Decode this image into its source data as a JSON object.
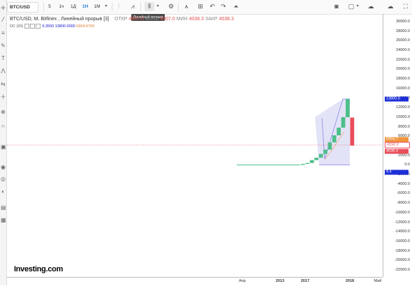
{
  "toolbar": {
    "symbol": "BTC/USD",
    "intervals": [
      "5",
      "1ч",
      "1Д",
      "1Н",
      "1М"
    ],
    "active_interval": "1Н",
    "tooltip": "Линейный прорыв"
  },
  "legend": {
    "title": "BTC/USD, M, Bitfinex , Линейный прорыв [3]",
    "open_label": "ОТКР",
    "open_value": "4907.0",
    "high_label": "МАКС",
    "high_value": "9907.0",
    "low_label": "МИН",
    "low_value": "4038.3",
    "close_label": "ЗАКР",
    "close_value": "4038.3"
  },
  "indicator": {
    "name": "DC (20)",
    "v1": "9.3500",
    "v2": "13800.0000",
    "v3": "6904.6750"
  },
  "yaxis": {
    "ticks": [
      "30000.0",
      "28000.0",
      "26000.0",
      "24000.0",
      "22000.0",
      "20000.0",
      "18000.0",
      "16000.0",
      "14000.0",
      "12000.0",
      "10000.0",
      "8000.0",
      "6000.0",
      "4000.0",
      "2000.0",
      "0.0",
      "-2000.0",
      "-4000.0",
      "-6000.0",
      "-8000.0",
      "-10000.0",
      "-12000.0",
      "-14000.0",
      "-16000.0",
      "-18000.0",
      "-20000.0",
      "-22000.0"
    ],
    "badges": {
      "upper": "13800.0",
      "mid": "6904.7",
      "price": "4150.0",
      "close": "4038.3",
      "lower": "9.4"
    }
  },
  "xaxis": {
    "ticks": [
      "Апр",
      "2013",
      "2017",
      "2018",
      "Май"
    ]
  },
  "logo": "Investing.com",
  "colors": {
    "up": "#4dbf8a",
    "down": "#e84f5c",
    "channel_fill": "#c8c8f0",
    "channel_line": "#8888ee",
    "price_line": "#e84f5c",
    "badge_blue": "#1c2fd8",
    "badge_orange": "#f0963c",
    "badge_red": "#e84f5c"
  },
  "chart_data": {
    "type": "line-break",
    "ylim": [
      -22000,
      30000
    ],
    "bricks": [
      {
        "open": 0,
        "close": 200,
        "dir": "up"
      },
      {
        "open": 200,
        "close": 400,
        "dir": "up"
      },
      {
        "open": 400,
        "close": 1000,
        "dir": "up"
      },
      {
        "open": 1000,
        "close": 1500,
        "dir": "up"
      },
      {
        "open": 1500,
        "close": 2300,
        "dir": "up"
      },
      {
        "open": 2300,
        "close": 3200,
        "dir": "up"
      },
      {
        "open": 3200,
        "close": 4700,
        "dir": "up"
      },
      {
        "open": 4700,
        "close": 6200,
        "dir": "up"
      },
      {
        "open": 6200,
        "close": 7800,
        "dir": "up"
      },
      {
        "open": 7800,
        "close": 10000,
        "dir": "up"
      },
      {
        "open": 10000,
        "close": 13800,
        "dir": "up"
      },
      {
        "open": 9907,
        "close": 4038,
        "dir": "down"
      }
    ],
    "donchian_upper": 13800,
    "donchian_lower": 9.4,
    "donchian_mid": 6904.7,
    "price_line": 4150
  }
}
